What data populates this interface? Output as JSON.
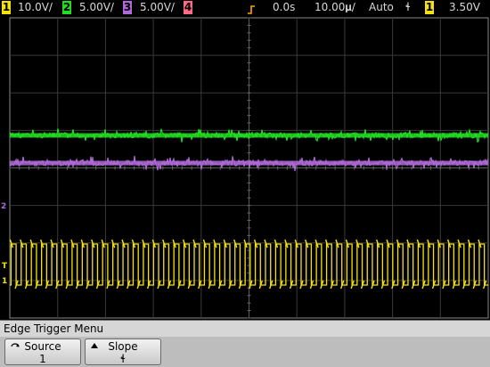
{
  "header": {
    "channels": [
      {
        "num": "1",
        "scale": "10.0V/",
        "color": "#f5e20a"
      },
      {
        "num": "2",
        "scale": "5.00V/",
        "color": "#22dd22"
      },
      {
        "num": "3",
        "scale": "5.00V/",
        "color": "#b06ad8"
      },
      {
        "num": "4",
        "scale": "",
        "color": "#ff6a85"
      }
    ],
    "time_delay": "0.0s",
    "time_base": "10.00𝛍/",
    "trigger_mode": "Auto",
    "trigger_slope_icon": "ɬ",
    "trigger_source": "1",
    "trigger_level": "3.50V"
  },
  "markers": {
    "ch2_ground": "2",
    "ch1_trigger_level": "T",
    "ch1_ground": "1"
  },
  "menu": {
    "title": "Edge Trigger Menu",
    "softkeys": [
      {
        "label": "Source",
        "value": "1",
        "icon": "rotate-knob-icon"
      },
      {
        "label": "Slope",
        "value": "ɬ",
        "icon": "up-arrow-icon"
      }
    ]
  },
  "traces": {
    "ch1": {
      "type": "digital-pulses",
      "color": "#f5e20a",
      "cycles": 47
    },
    "ch2": {
      "type": "noisy-dc",
      "color": "#22dd22"
    },
    "ch3": {
      "type": "noisy-dc",
      "color": "#b06ad8"
    }
  }
}
